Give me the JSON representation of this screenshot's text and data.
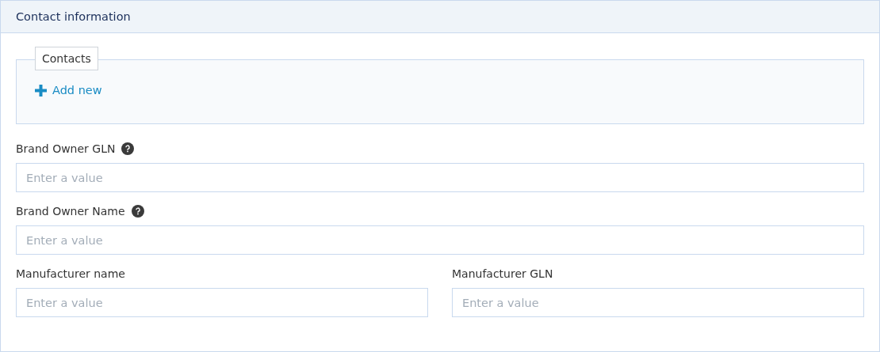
{
  "panel": {
    "title": "Contact information"
  },
  "contacts": {
    "legend": "Contacts",
    "add_label": "Add new"
  },
  "rows": [
    {
      "fields": [
        {
          "label": "Brand Owner GLN",
          "help": true,
          "placeholder": "Enter a value"
        }
      ]
    },
    {
      "fields": [
        {
          "label": "Brand Owner Name",
          "help": true,
          "placeholder": "Enter a value"
        }
      ]
    },
    {
      "fields": [
        {
          "label": "Manufacturer name",
          "help": false,
          "placeholder": "Enter a value"
        },
        {
          "label": "Manufacturer GLN",
          "help": false,
          "placeholder": "Enter a value"
        }
      ]
    }
  ]
}
